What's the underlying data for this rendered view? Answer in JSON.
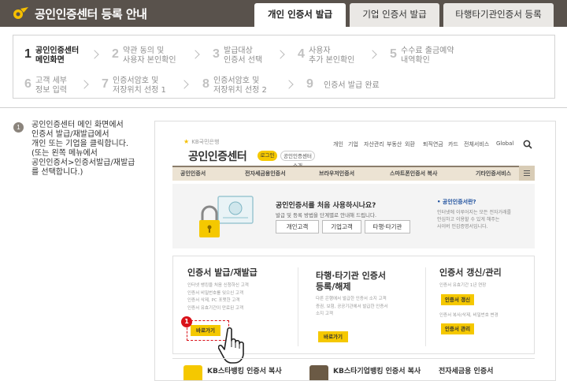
{
  "header": {
    "title": "공인인증센터 등록 안내",
    "tabs": [
      {
        "label": "개인 인증서 발급",
        "active": true
      },
      {
        "label": "기업 인증서 발급",
        "active": false
      },
      {
        "label": "타행타기관인증서 등록",
        "active": false
      }
    ]
  },
  "steps": [
    {
      "num": "1",
      "line1": "공인인증센터",
      "line2": "메인화면",
      "current": true
    },
    {
      "num": "2",
      "line1": "약관 동의 및",
      "line2": "사용자 본인확인",
      "current": false
    },
    {
      "num": "3",
      "line1": "발급대상",
      "line2": "인증서 선택",
      "current": false
    },
    {
      "num": "4",
      "line1": "사용자",
      "line2": "추가 본인확인",
      "current": false
    },
    {
      "num": "5",
      "line1": "수수료 출금예약",
      "line2": "내역확인",
      "current": false
    },
    {
      "num": "6",
      "line1": "고객 세부",
      "line2": "정보 입력",
      "current": false
    },
    {
      "num": "7",
      "line1": "인증서암호 및",
      "line2": "저장위치 선정 1",
      "current": false
    },
    {
      "num": "8",
      "line1": "인증서암호 및",
      "line2": "저장위치 선정 2",
      "current": false
    },
    {
      "num": "9",
      "line1": "인증서 발급 완료",
      "line2": "",
      "current": false
    }
  ],
  "instruction": {
    "num": "1",
    "lines": [
      "공인인증센터 메인 화면에서",
      "인증서 발급/재발급에서",
      "개인 또는 기업을 클릭합니다.",
      "(또는 왼쪽 메뉴에서",
      "공인인증서>인증서발급/재발급",
      "를 선택합니다.)"
    ]
  },
  "mock": {
    "bank": "KB국민은행",
    "site_title": "공인인증센터",
    "login": "로그인",
    "intro": "공인인증센터 소개",
    "topnav": [
      "개인",
      "기업",
      "자산관리",
      "부동산",
      "외환",
      "퇴직연금",
      "카드",
      "전체서비스",
      "Global"
    ],
    "mainnav": [
      "공인인증서",
      "전자세금용인증서",
      "브라우저인증서",
      "스마트폰인증서 복사",
      "기타인증서비스"
    ],
    "hero_question": "공인인증서를 처음 사용하시나요?",
    "hero_sub": "발급 및 등록 방법을 단계별로 안내해 드립니다.",
    "hero_buttons": [
      "개인고객",
      "기업고객",
      "타행·타기관"
    ],
    "side_title": "• 공인인증서란?",
    "side_desc": [
      "인터넷에 이루어지는 모든 전자거래를",
      "안심하고 이용할 수 있게 해주는",
      "사이버 인감증명서입니다."
    ],
    "col1_title": "인증서 발급/재발급",
    "col1_desc": [
      "인터넷 뱅킹을 처음 신청하신 고객",
      "인증서 비밀번호를 잊으신 고객",
      "인증서 삭제, PC 포맷한 고객",
      "인증서 유효기간이 만료된 고객"
    ],
    "col1_btn": "바로가기",
    "col2_title": [
      "타행·타기관 인증서",
      "등록/해제"
    ],
    "col2_desc": [
      "다른 은행에서 발급한 인증서 소지 고객",
      "증권, 보험, 공공기관에서 발급한 인증서",
      "소지 고객"
    ],
    "col2_btn": "바로가기",
    "col3_title": "인증서 갱신/관리",
    "col3_desc1": "인증서 유효기간 1년 연장",
    "col3_btn1": "인증서 갱신",
    "col3_desc2": "인증서 복사/삭제, 비밀번호 변경",
    "col3_btn2": "인증서 관리",
    "callout": "1",
    "bottom": [
      "KB스타뱅킹 인증서 복사",
      "KB스타기업뱅킹 인증서 복사",
      "전자세금용 인증서"
    ]
  },
  "colors": {
    "topbar": "#59524c",
    "accent": "#f5c800",
    "callout": "#d9121a"
  }
}
